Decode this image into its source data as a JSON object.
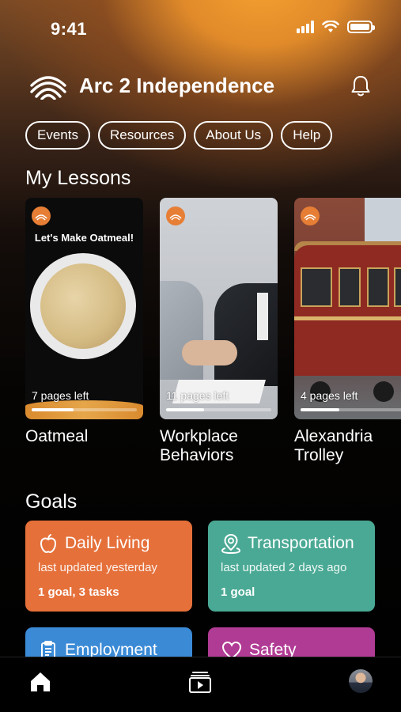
{
  "status_bar": {
    "time": "9:41"
  },
  "header": {
    "app_title": "Arc 2 Independence",
    "icon_logo": "arc-logo",
    "icon_bell": "bell-icon"
  },
  "nav_pills": [
    "Events",
    "Resources",
    "About Us",
    "Help"
  ],
  "lessons_section": {
    "title": "My Lessons",
    "items": [
      {
        "name": "Oatmeal",
        "card_caption": "Let's Make Oatmeal!",
        "pages_left": "7 pages left",
        "progress": 0.4
      },
      {
        "name": "Workplace Behaviors",
        "pages_left": "11 pages left",
        "progress": 0.36
      },
      {
        "name": "Alexandria Trolley",
        "pages_left": "4 pages left",
        "progress": 0.37
      }
    ]
  },
  "goals_section": {
    "title": "Goals",
    "items": [
      {
        "title": "Daily Living",
        "updated": "last updated yesterday",
        "count": "1 goal, 3 tasks",
        "color": "#e5703a",
        "icon": "apple-icon"
      },
      {
        "title": "Transportation",
        "updated": "last updated 2 days ago",
        "count": "1 goal",
        "color": "#4aa994",
        "icon": "location-pin-icon"
      },
      {
        "title": "Employment",
        "color": "#3a8ad6",
        "icon": "clipboard-icon"
      },
      {
        "title": "Safety",
        "color": "#b03b94",
        "icon": "heart-icon"
      }
    ]
  },
  "tab_bar": {
    "items": [
      "home-icon",
      "media-icon",
      "profile-avatar"
    ]
  }
}
